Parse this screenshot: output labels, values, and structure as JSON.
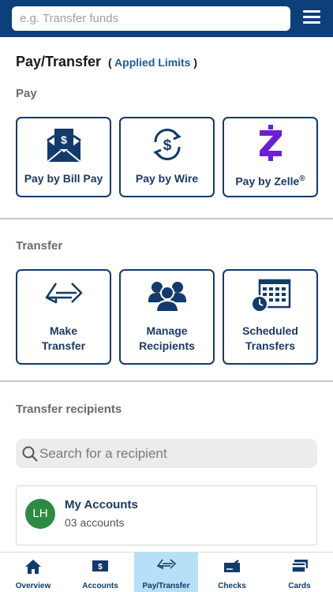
{
  "search": {
    "placeholder": "e.g. Transfer funds"
  },
  "header": {
    "title": "Pay/Transfer",
    "limits_open": "(",
    "limits_link": "Applied Limits",
    "limits_close": ")"
  },
  "pay": {
    "section_label": "Pay",
    "tiles": [
      {
        "label": "Pay by Bill Pay",
        "icon": "bill-pay-envelope-icon"
      },
      {
        "label": "Pay by Wire",
        "icon": "wire-dollar-icon"
      },
      {
        "label": "Pay by Zelle",
        "label_sup": "®",
        "icon": "zelle-icon"
      }
    ]
  },
  "transfer": {
    "section_label": "Transfer",
    "tiles": [
      {
        "line1": "Make",
        "line2": "Transfer",
        "icon": "transfer-arrows-icon"
      },
      {
        "line1": "Manage",
        "line2": "Recipients",
        "icon": "recipients-group-icon"
      },
      {
        "line1": "Scheduled",
        "line2": "Transfers",
        "icon": "calendar-clock-icon"
      }
    ]
  },
  "recipients": {
    "section_label": "Transfer recipients",
    "search_placeholder": "Search for a recipient",
    "items": [
      {
        "initials": "LH",
        "name": "My Accounts",
        "subtitle": "03 accounts"
      }
    ]
  },
  "bottom_nav": {
    "active": "Pay/Transfer",
    "items": [
      {
        "label": "Overview",
        "icon": "home-icon"
      },
      {
        "label": "Accounts",
        "icon": "accounts-dollar-icon"
      },
      {
        "label": "Pay/Transfer",
        "icon": "pay-transfer-icon"
      },
      {
        "label": "Checks",
        "icon": "check-icon"
      },
      {
        "label": "Cards",
        "icon": "cards-icon"
      }
    ]
  },
  "colors": {
    "brand_navy": "#0d3f7a",
    "tile_border": "#123a6b",
    "link_blue": "#1d5aa8",
    "zelle_purple": "#6d1ed4",
    "avatar_green": "#2e8a43",
    "nav_active": "#b5e0f7"
  }
}
